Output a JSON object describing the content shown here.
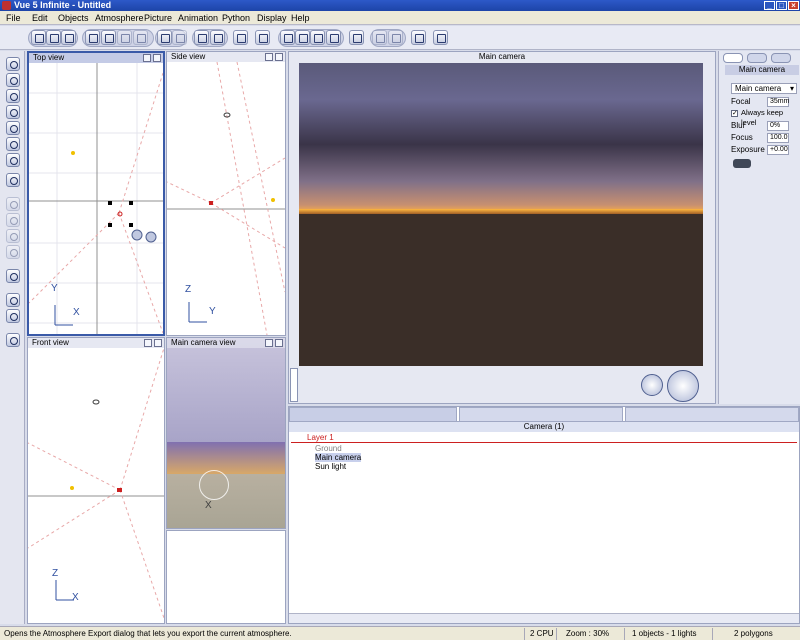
{
  "window": {
    "title": "Vue 5 Infinite - Untitled",
    "minimize": "_",
    "maximize": "□",
    "close": "×"
  },
  "menu": [
    "File",
    "Edit",
    "Objects",
    "Atmosphere",
    "Picture",
    "Animation",
    "Python",
    "Display",
    "Help"
  ],
  "views": {
    "top": {
      "title": "Top view",
      "axis_v": "Y",
      "axis_h": "X"
    },
    "side": {
      "title": "Side view",
      "axis_v": "Z",
      "axis_h": "Y"
    },
    "front": {
      "title": "Front view",
      "axis_v": "Z",
      "axis_h": "X"
    },
    "camera_small": {
      "title": "Main camera view",
      "axis": "X"
    },
    "main_camera": {
      "title": "Main camera"
    }
  },
  "camera_panel": {
    "header": "Main camera",
    "selector": "Main camera",
    "focal_label": "Focal",
    "focal_value": "35mm",
    "always_keep_level": "Always keep level",
    "blur_label": "Blur",
    "blur_value": "0%",
    "focus_label": "Focus",
    "focus_value": "100.0",
    "exposure_label": "Exposure",
    "exposure_value": "+0.00"
  },
  "world_browser": {
    "tab_title": "Camera (1)",
    "tree": [
      "Layer 1",
      "Ground",
      "Main camera",
      "Sun light"
    ]
  },
  "status": {
    "message": "Opens the Atmosphere Export dialog that lets you export the current atmosphere.",
    "cpu": "2 CPU",
    "zoom": "Zoom : 30%",
    "objects": "1 objects - 1 lights",
    "polygons": "2 polygons"
  },
  "colors": {
    "titlebar": "#2d59c8",
    "selection_red": "#cc2020",
    "sun_yellow": "#f0c000",
    "ground_brown": "#3a2e28"
  }
}
